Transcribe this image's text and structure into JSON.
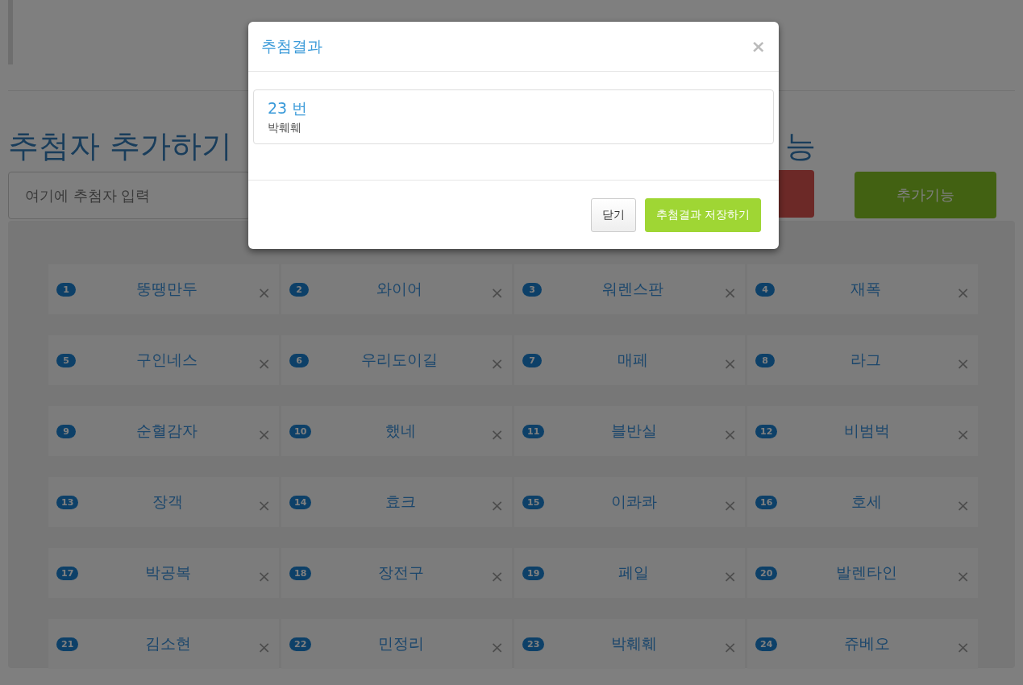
{
  "add_section": {
    "heading": "추첨자 추가하기",
    "input": {
      "placeholder": "여기에 추첨자 입력"
    }
  },
  "extra_section": {
    "heading": "능",
    "button": "추가기능"
  },
  "entries": [
    {
      "number": "1",
      "name": "뚱땡만두",
      "remove": "×"
    },
    {
      "number": "2",
      "name": "와이어",
      "remove": "×"
    },
    {
      "number": "3",
      "name": "워렌스판",
      "remove": "×"
    },
    {
      "number": "4",
      "name": "재폭",
      "remove": "×"
    },
    {
      "number": "5",
      "name": "구인네스",
      "remove": "×"
    },
    {
      "number": "6",
      "name": "우리도이길",
      "remove": "×"
    },
    {
      "number": "7",
      "name": "매페",
      "remove": "×"
    },
    {
      "number": "8",
      "name": "라그",
      "remove": "×"
    },
    {
      "number": "9",
      "name": "순혈감자",
      "remove": "×"
    },
    {
      "number": "10",
      "name": "했네",
      "remove": "×"
    },
    {
      "number": "11",
      "name": "블반실",
      "remove": "×"
    },
    {
      "number": "12",
      "name": "비범벅",
      "remove": "×"
    },
    {
      "number": "13",
      "name": "장객",
      "remove": "×"
    },
    {
      "number": "14",
      "name": "효크",
      "remove": "×"
    },
    {
      "number": "15",
      "name": "이콰콰",
      "remove": "×"
    },
    {
      "number": "16",
      "name": "호세",
      "remove": "×"
    },
    {
      "number": "17",
      "name": "박공복",
      "remove": "×"
    },
    {
      "number": "18",
      "name": "장전구",
      "remove": "×"
    },
    {
      "number": "19",
      "name": "페일",
      "remove": "×"
    },
    {
      "number": "20",
      "name": "발렌타인",
      "remove": "×"
    },
    {
      "number": "21",
      "name": "김소현",
      "remove": "×"
    },
    {
      "number": "22",
      "name": "민정리",
      "remove": "×"
    },
    {
      "number": "23",
      "name": "박훼훼",
      "remove": "×"
    },
    {
      "number": "24",
      "name": "쥬베오",
      "remove": "×"
    }
  ],
  "modal": {
    "title": "추첨결과",
    "close": "×",
    "result": {
      "number": "23 번",
      "name": "박훼훼"
    },
    "buttons": [
      {
        "label": "닫기",
        "kind": "default"
      },
      {
        "label": "추첨결과 저장하기",
        "kind": "success"
      }
    ]
  }
}
